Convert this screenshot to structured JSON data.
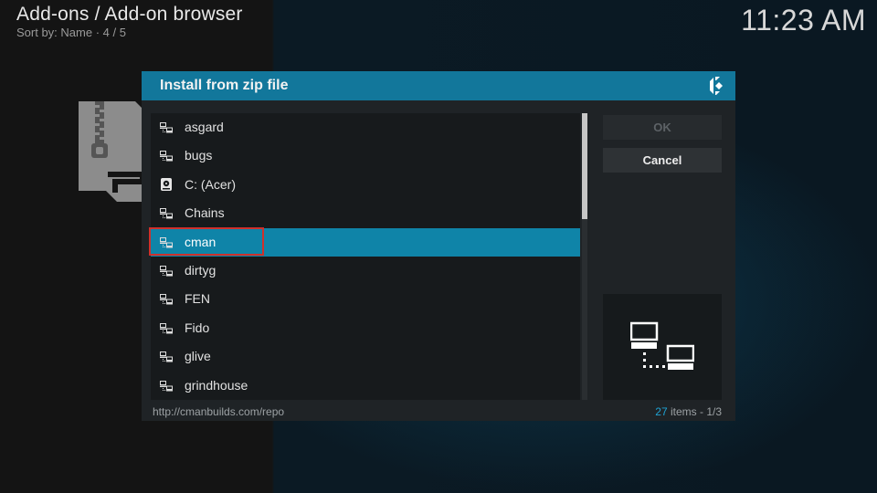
{
  "header": {
    "title": "Add-ons / Add-on browser",
    "subtitle": "Sort by: Name  ·  4 / 5"
  },
  "clock": "11:23 AM",
  "dialog": {
    "title": "Install from zip file",
    "items": [
      {
        "label": "asgard",
        "icon": "network-share-icon"
      },
      {
        "label": "bugs",
        "icon": "network-share-icon"
      },
      {
        "label": "C: (Acer)",
        "icon": "hard-drive-icon"
      },
      {
        "label": "Chains",
        "icon": "network-share-icon"
      },
      {
        "label": "cman",
        "icon": "network-share-icon",
        "selected": true
      },
      {
        "label": "dirtyg",
        "icon": "network-share-icon"
      },
      {
        "label": "FEN",
        "icon": "network-share-icon"
      },
      {
        "label": "Fido",
        "icon": "network-share-icon"
      },
      {
        "label": "glive",
        "icon": "network-share-icon"
      },
      {
        "label": "grindhouse",
        "icon": "network-share-icon"
      }
    ],
    "buttons": {
      "ok_label": "OK",
      "cancel_label": "Cancel"
    },
    "footer": {
      "path": "http://cmanbuilds.com/repo",
      "item_count": "27",
      "items_text": " items - ",
      "page": "1/3"
    },
    "scroll_position_fraction": 0.0,
    "visible_fraction": 0.37
  },
  "colors": {
    "accent": "#12779b",
    "selection": "#0f84a8",
    "highlight_outline": "#d0302b",
    "count_highlight": "#1fa3d4"
  }
}
